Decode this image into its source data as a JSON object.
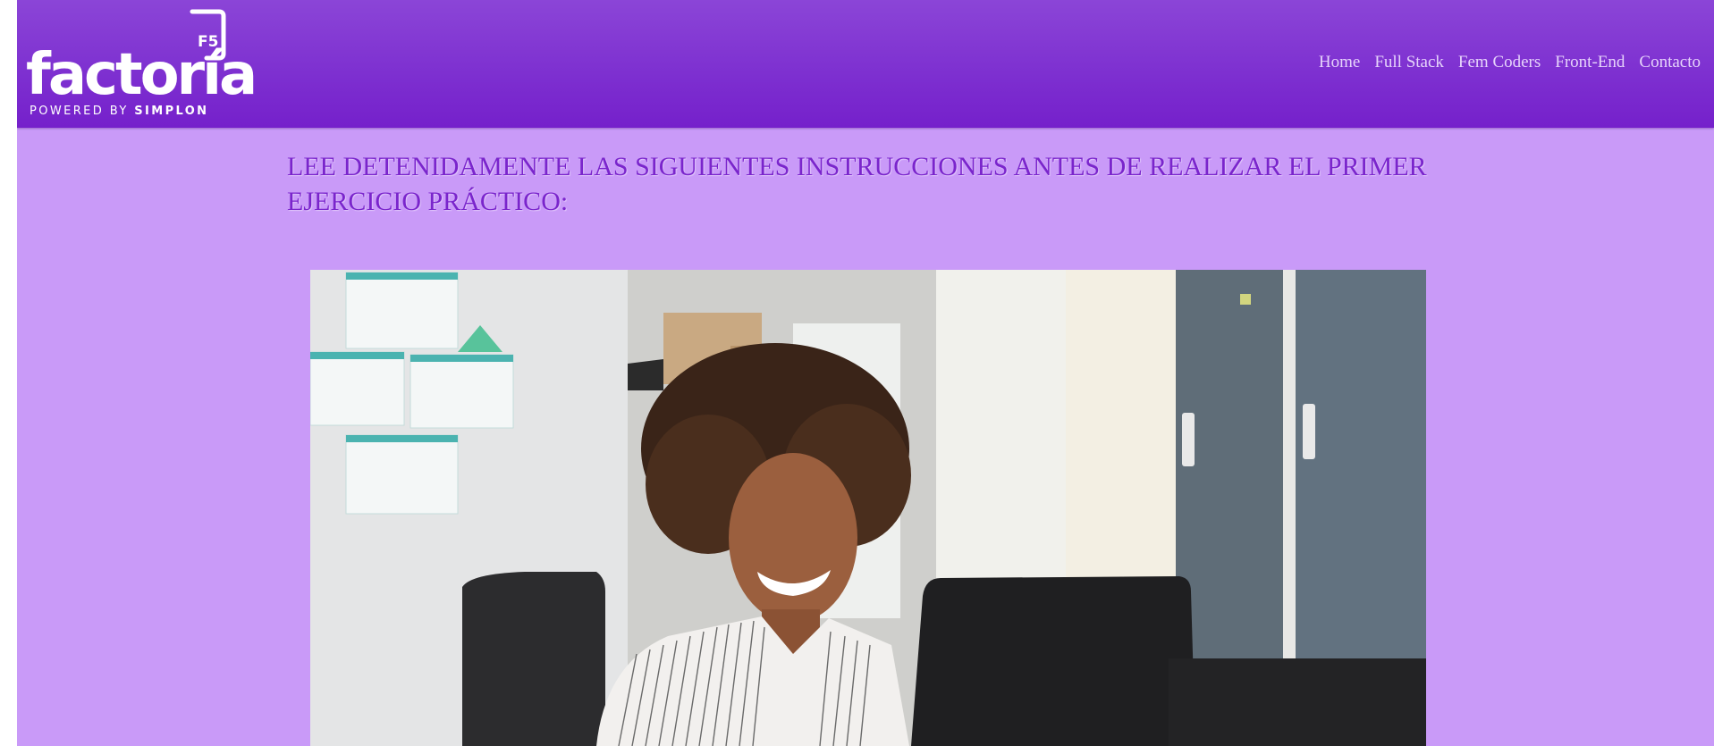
{
  "header": {
    "logo": {
      "wordmark": "factoría",
      "badge": "F5",
      "tagline_prefix": "POWERED BY",
      "tagline_brand": "SIMPLON"
    },
    "nav": [
      {
        "label": "Home"
      },
      {
        "label": "Full Stack"
      },
      {
        "label": "Fem Coders"
      },
      {
        "label": "Front-End"
      },
      {
        "label": "Contacto"
      }
    ]
  },
  "main": {
    "heading": "LEE DETENIDAMENTE LAS SIGUIENTES INSTRUCCIONES ANTES DE REALIZAR EL PRIMER EJERCICIO PRÁCTICO:",
    "image": {
      "alt": "Mujer sonriendo frente a un ordenador portátil en una oficina"
    }
  },
  "colors": {
    "header": "#7d2fd0",
    "background": "#c99af8",
    "heading_text": "#7a25cc",
    "nav_text": "#e6d3fb"
  }
}
